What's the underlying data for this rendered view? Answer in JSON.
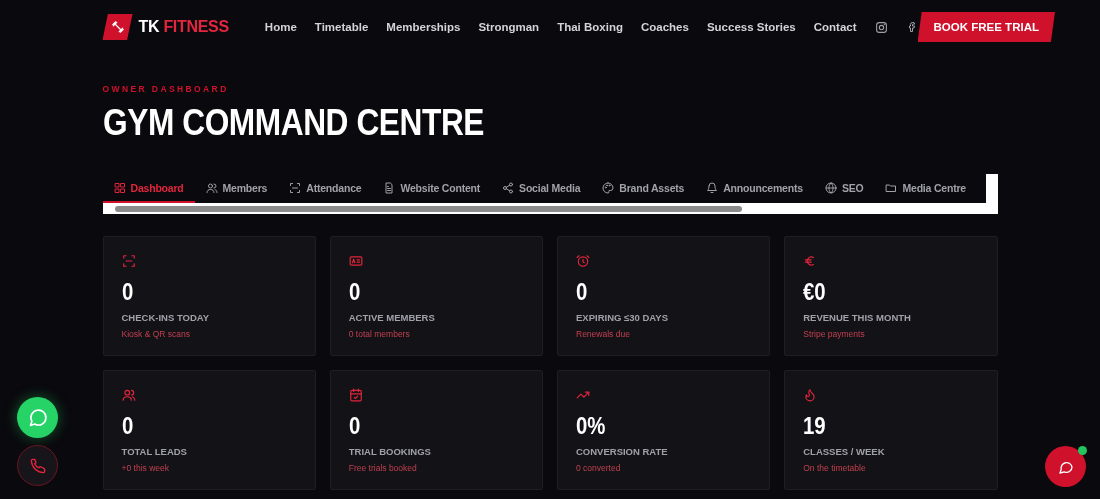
{
  "brand": {
    "first": "TK",
    "second": "FITNESS"
  },
  "nav": [
    "Home",
    "Timetable",
    "Memberships",
    "Strongman",
    "Thai Boxing",
    "Coaches",
    "Success Stories",
    "Contact"
  ],
  "cta": "BOOK FREE TRIAL",
  "eyebrow": "OWNER DASHBOARD",
  "title": "GYM COMMAND CENTRE",
  "tabs": [
    {
      "label": "Dashboard",
      "selected": true
    },
    {
      "label": "Members",
      "selected": false
    },
    {
      "label": "Attendance",
      "selected": false
    },
    {
      "label": "Website Content",
      "selected": false
    },
    {
      "label": "Social Media",
      "selected": false
    },
    {
      "label": "Brand Assets",
      "selected": false
    },
    {
      "label": "Announcements",
      "selected": false
    },
    {
      "label": "SEO",
      "selected": false
    },
    {
      "label": "Media Centre",
      "selected": false
    }
  ],
  "stats": [
    {
      "value": "0",
      "label": "CHECK-INS TODAY",
      "note": "Kiosk & QR scans"
    },
    {
      "value": "0",
      "label": "ACTIVE MEMBERS",
      "note": "0 total members"
    },
    {
      "value": "0",
      "label": "EXPIRING ≤30 DAYS",
      "note": "Renewals due"
    },
    {
      "value": "€0",
      "label": "REVENUE THIS MONTH",
      "note": "Stripe payments"
    },
    {
      "value": "0",
      "label": "TOTAL LEADS",
      "note": "+0 this week"
    },
    {
      "value": "0",
      "label": "TRIAL BOOKINGS",
      "note": "Free trials booked"
    },
    {
      "value": "0%",
      "label": "CONVERSION RATE",
      "note": "0 converted"
    },
    {
      "value": "19",
      "label": "CLASSES / WEEK",
      "note": "On the timetable"
    }
  ]
}
